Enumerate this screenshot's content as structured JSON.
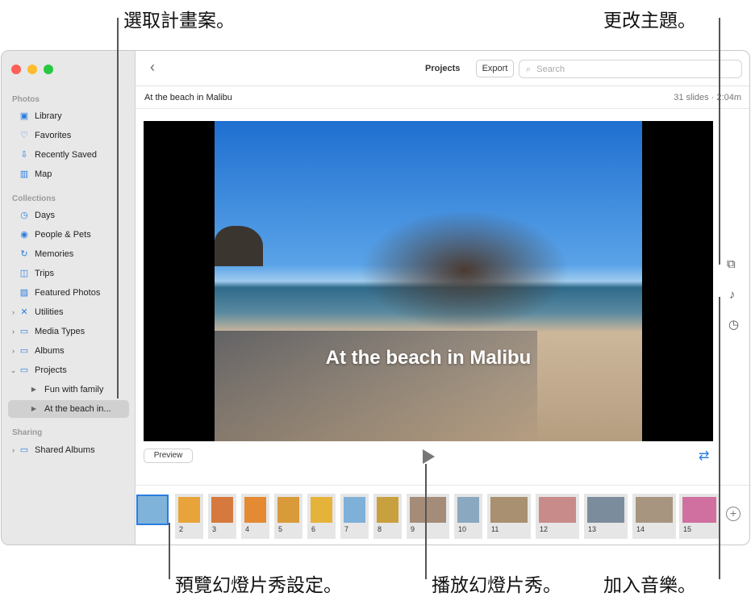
{
  "callouts": {
    "select_project": "選取計畫案。",
    "change_theme": "更改主題。",
    "preview_settings": "預覽幻燈片秀設定。",
    "play_slideshow": "播放幻燈片秀。",
    "add_music": "加入音樂。"
  },
  "sidebar": {
    "sections": [
      {
        "label": "Photos"
      },
      {
        "label": "Collections"
      },
      {
        "label": "Sharing"
      }
    ],
    "items": [
      {
        "label": "Library",
        "icon": "library-icon"
      },
      {
        "label": "Favorites",
        "icon": "heart-icon"
      },
      {
        "label": "Recently Saved",
        "icon": "download-icon"
      },
      {
        "label": "Map",
        "icon": "map-icon"
      },
      {
        "label": "Days",
        "icon": "clock-icon"
      },
      {
        "label": "People & Pets",
        "icon": "person-icon"
      },
      {
        "label": "Memories",
        "icon": "memories-icon"
      },
      {
        "label": "Trips",
        "icon": "suitcase-icon"
      },
      {
        "label": "Featured Photos",
        "icon": "photo-icon"
      },
      {
        "label": "Utilities",
        "icon": "tools-icon"
      },
      {
        "label": "Media Types",
        "icon": "folder-icon"
      },
      {
        "label": "Albums",
        "icon": "folder-icon"
      },
      {
        "label": "Projects",
        "icon": "folder-icon"
      },
      {
        "label": "Fun with family",
        "icon": "slideshow-icon"
      },
      {
        "label": "At the beach in...",
        "icon": "slideshow-icon"
      },
      {
        "label": "Shared Albums",
        "icon": "shared-folder-icon"
      }
    ]
  },
  "toolbar": {
    "title": "Projects",
    "export": "Export",
    "search_placeholder": "Search"
  },
  "project": {
    "name": "At the beach in Malibu",
    "info": "31 slides · 2:04m",
    "caption": "At the beach in Malibu"
  },
  "controls": {
    "preview": "Preview"
  },
  "thumbnails": [
    "",
    "2",
    "3",
    "4",
    "5",
    "6",
    "7",
    "8",
    "9",
    "10",
    "11",
    "12",
    "13",
    "14",
    "15"
  ],
  "colors": {
    "accent": "#2a7de1"
  }
}
